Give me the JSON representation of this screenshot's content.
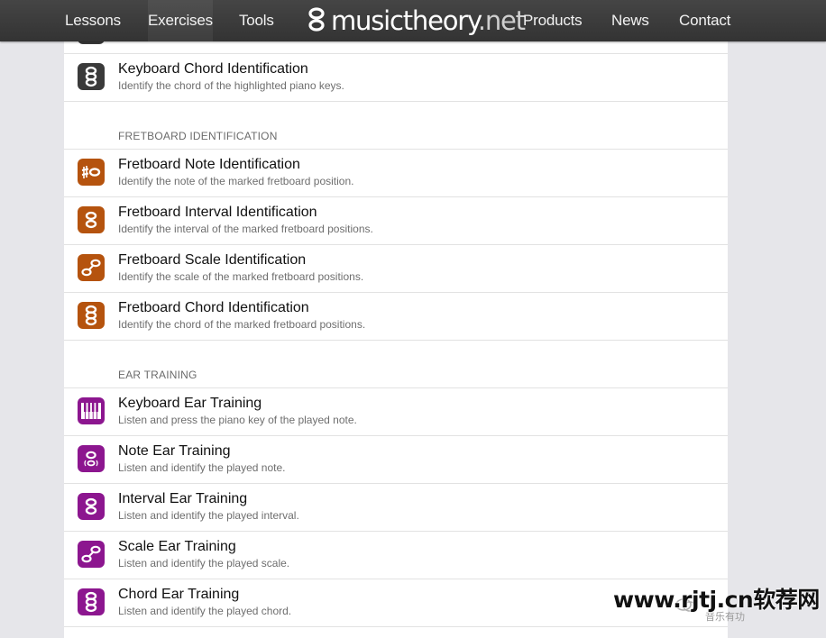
{
  "nav": {
    "left": [
      "Lessons",
      "Exercises",
      "Tools"
    ],
    "active": "Exercises",
    "logo_main": "musictheory",
    "logo_tld": ".net",
    "right": [
      "Products",
      "News",
      "Contact"
    ]
  },
  "colors": {
    "topbar": "#3b3b3b",
    "keyboard_icon": "#3a3a3a",
    "fretboard_icon": "#b5530e",
    "ear_icon": "#8c168f"
  },
  "rows_top": [
    {
      "title": "Keyboard Chord Identification",
      "desc": "Identify the chord of the highlighted piano keys.",
      "icon": "chord-icon"
    }
  ],
  "sections": [
    {
      "header": "FRETBOARD IDENTIFICATION",
      "items": [
        {
          "title": "Fretboard Note Identification",
          "desc": "Identify the note of the marked fretboard position.",
          "icon": "note-icon"
        },
        {
          "title": "Fretboard Interval Identification",
          "desc": "Identify the interval of the marked fretboard positions.",
          "icon": "interval-icon"
        },
        {
          "title": "Fretboard Scale Identification",
          "desc": "Identify the scale of the marked fretboard positions.",
          "icon": "scale-icon"
        },
        {
          "title": "Fretboard Chord Identification",
          "desc": "Identify the chord of the marked fretboard positions.",
          "icon": "chord-icon"
        }
      ]
    },
    {
      "header": "EAR TRAINING",
      "items": [
        {
          "title": "Keyboard Ear Training",
          "desc": "Listen and press the piano key of the played note.",
          "icon": "piano-keys-icon"
        },
        {
          "title": "Note Ear Training",
          "desc": "Listen and identify the played note.",
          "icon": "note-icon"
        },
        {
          "title": "Interval Ear Training",
          "desc": "Listen and identify the played interval.",
          "icon": "interval-icon"
        },
        {
          "title": "Scale Ear Training",
          "desc": "Listen and identify the played scale.",
          "icon": "scale-icon"
        },
        {
          "title": "Chord Ear Training",
          "desc": "Listen and identify the played chord.",
          "icon": "chord-icon"
        }
      ]
    }
  ],
  "watermark": {
    "text": "www.rjtj.cn软荐网",
    "sub": "音乐有功"
  }
}
